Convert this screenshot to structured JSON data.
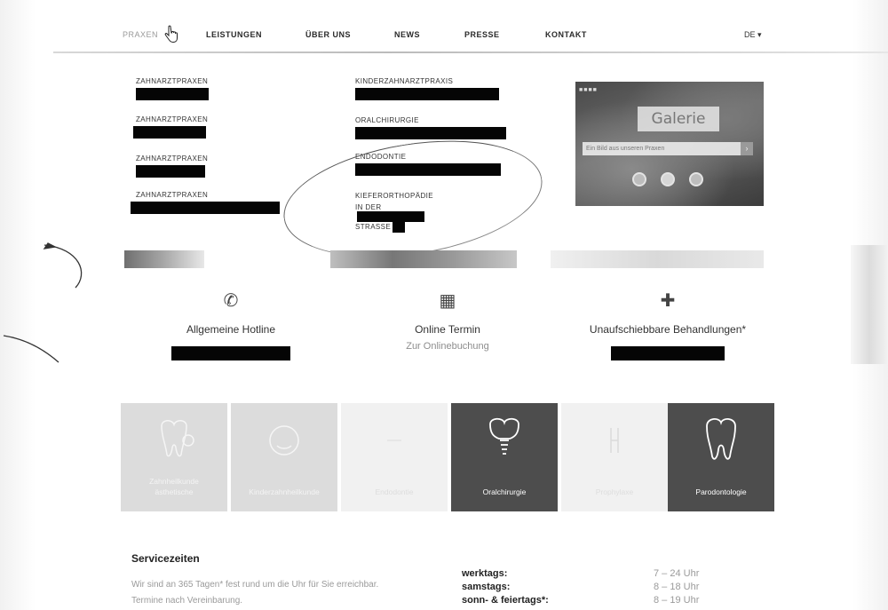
{
  "nav": {
    "items": [
      {
        "label": "PRAXEN"
      },
      {
        "label": "LEISTUNGEN"
      },
      {
        "label": "ÜBER UNS"
      },
      {
        "label": "NEWS"
      },
      {
        "label": "PRESSE"
      },
      {
        "label": "KONTAKT"
      }
    ],
    "language": "DE ▾"
  },
  "dropdown": {
    "left": [
      {
        "label": "ZAHNARZTPRAXEN"
      },
      {
        "label": "ZAHNARZTPRAXEN"
      },
      {
        "label": "ZAHNARZTPRAXEN"
      },
      {
        "label": "ZAHNARZTPRAXEN"
      }
    ],
    "right": [
      {
        "label": "KINDERZAHNARZTPRAXIS"
      },
      {
        "label": "ORALCHIRURGIE"
      },
      {
        "label": "ENDODONTIE"
      },
      {
        "label": "KIEFERORTHOPÄDIE",
        "line2_prefix": "IN DER",
        "line2_suffix": "STRASSE"
      }
    ]
  },
  "gallery": {
    "title": "Galerie",
    "search_placeholder": "Ein Bild aus unseren Praxen",
    "search_button": "›"
  },
  "info": [
    {
      "icon": "phone-icon",
      "label": "Allgemeine Hotline"
    },
    {
      "icon": "calendar-icon",
      "label": "Online Termin",
      "sub": "Zur Onlinebuchung"
    },
    {
      "icon": "medical-cross-icon",
      "label": "Unaufschiebbare Behandlungen*"
    }
  ],
  "tiles": [
    {
      "label1": "Zahnheilkunde",
      "label2": "ästhetische",
      "style": "light",
      "icon": "tooth-check-icon"
    },
    {
      "label1": "Kinderzahnheilkunde",
      "style": "light",
      "icon": "child-face-icon"
    },
    {
      "label1": "Endodontie",
      "style": "pale",
      "icon": "root-icon"
    },
    {
      "label1": "Oralchirurgie",
      "style": "dark",
      "icon": "implant-icon"
    },
    {
      "label1": "Prophylaxe",
      "style": "pale",
      "icon": "toothbrush-icon"
    },
    {
      "label1": "Parodontologie",
      "style": "dark",
      "icon": "tooth-icon"
    }
  ],
  "service": {
    "title": "Servicezeiten",
    "text": "Wir sind an 365 Tagen* fest rund um die Uhr für Sie erreichbar. Termine nach Vereinbarung.",
    "hours": [
      {
        "day": "werktags:",
        "time": "7 – 24 Uhr"
      },
      {
        "day": "samstags:",
        "time": "8 – 18 Uhr"
      },
      {
        "day": "sonn- & feiertags*:",
        "time": "8 – 19 Uhr"
      }
    ]
  },
  "colors": {
    "tile_dark": "#4d4d4d",
    "tile_light": "#dcdcdc",
    "redaction": "#050505"
  }
}
